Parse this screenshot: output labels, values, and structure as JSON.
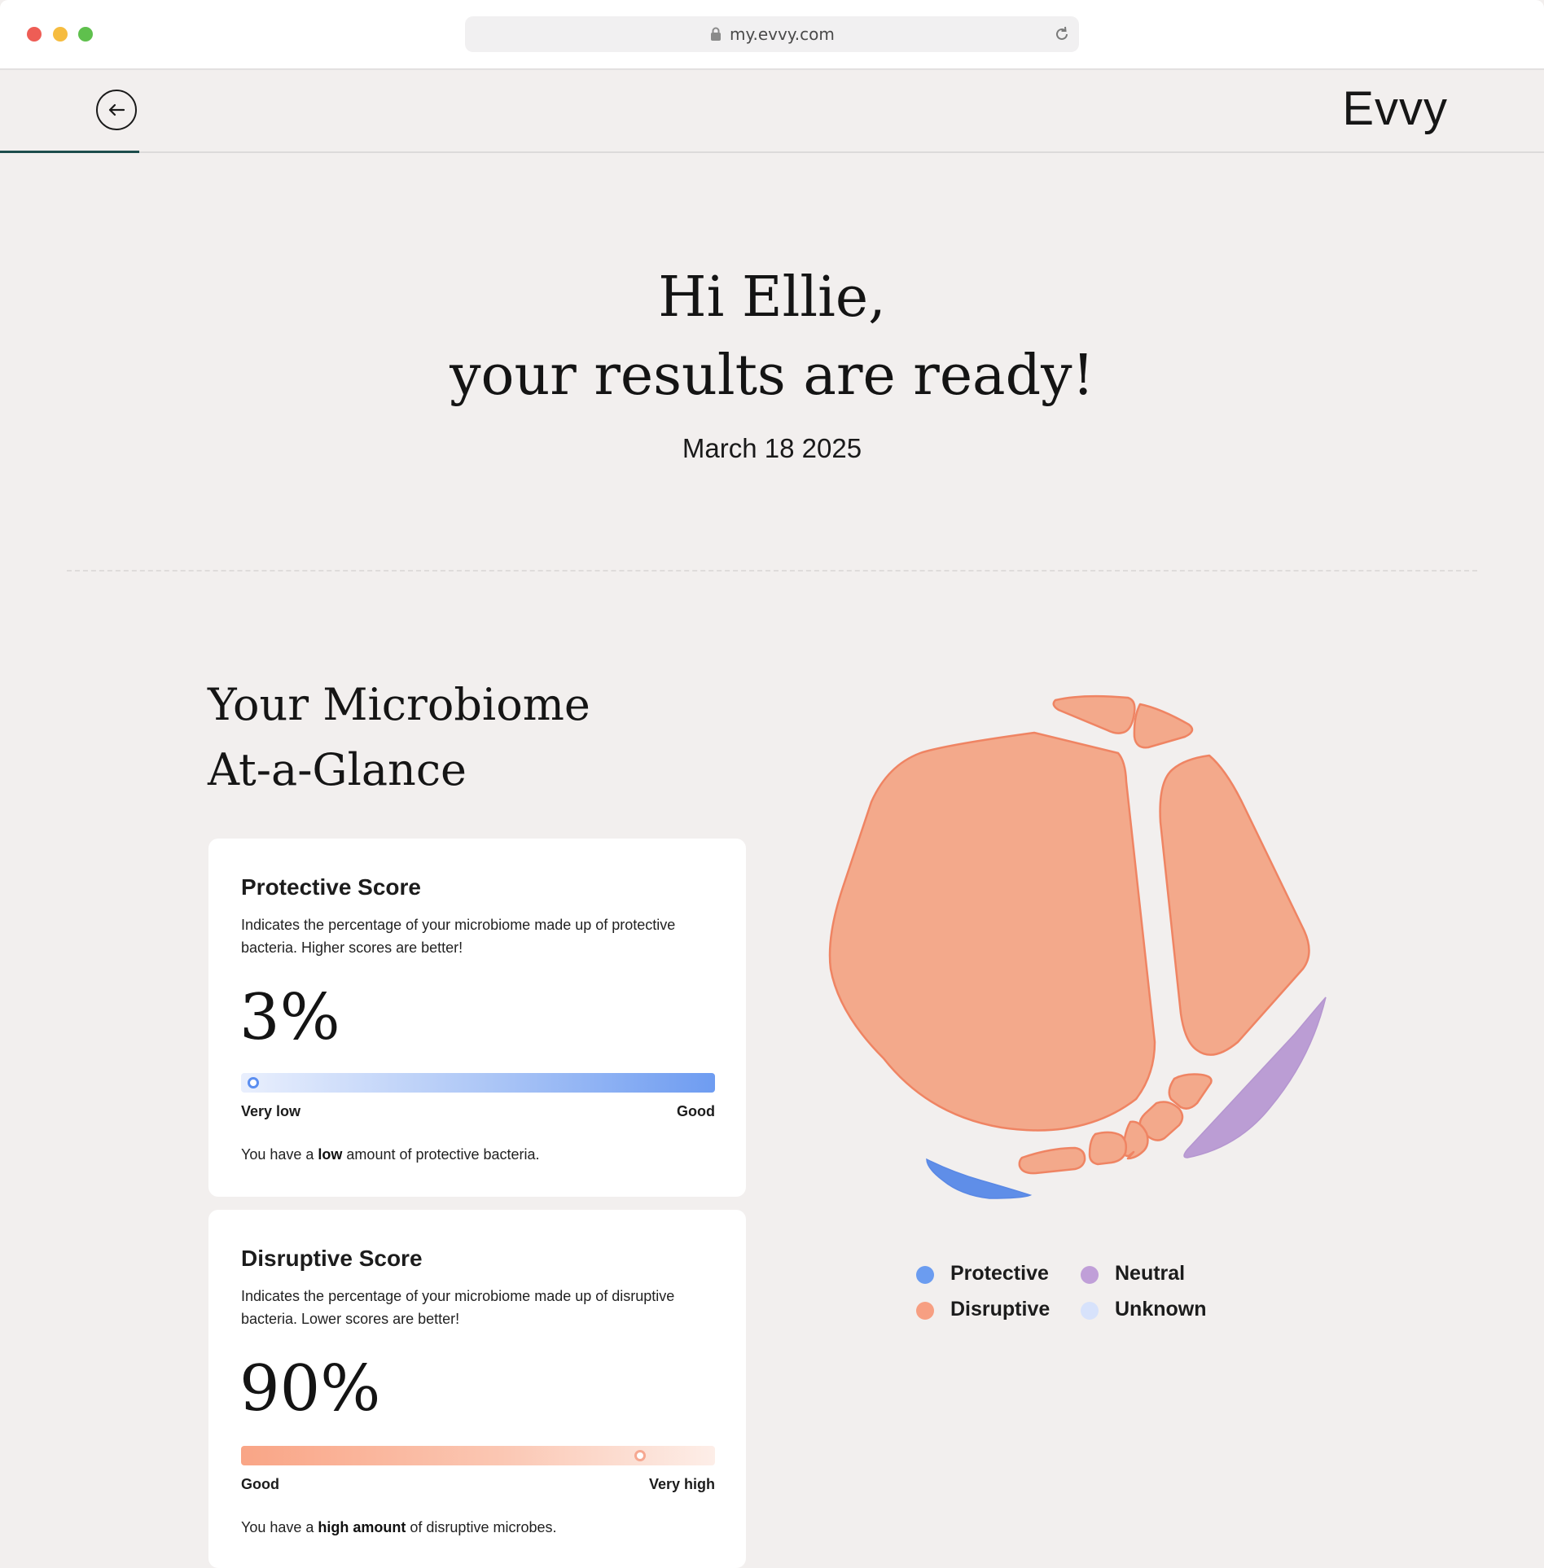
{
  "browser": {
    "url": "my.evvy.com"
  },
  "header": {
    "logo": "Evvy"
  },
  "hero": {
    "greeting": "Hi Ellie,",
    "headline": "your results are ready!",
    "date": "March 18 2025"
  },
  "section": {
    "title_line1": "Your Microbiome",
    "title_line2": "At-a-Glance"
  },
  "cards": {
    "protective": {
      "title": "Protective Score",
      "description": "Indicates the percentage of your microbiome made up of protective bacteria. Higher scores are better!",
      "score": "3%",
      "score_fraction": 0.03,
      "label_left": "Very low",
      "label_right": "Good",
      "summary_prefix": "You have a ",
      "summary_bold": "low",
      "summary_suffix": " amount of protective bacteria."
    },
    "disruptive": {
      "title": "Disruptive Score",
      "description": "Indicates the percentage of your microbiome made up of disruptive bacteria. Lower scores are better!",
      "score": "90%",
      "score_fraction": 0.9,
      "label_left": "Good",
      "label_right": "Very high",
      "summary_prefix": "You have a ",
      "summary_bold": "high amount",
      "summary_suffix": " of disruptive microbes."
    }
  },
  "legend": {
    "protective": {
      "label": "Protective",
      "color": "#6b9cf0"
    },
    "neutral": {
      "label": "Neutral",
      "color": "#c09fd8"
    },
    "disruptive": {
      "label": "Disruptive",
      "color": "#f79f82"
    },
    "unknown": {
      "label": "Unknown",
      "color": "#d7e2fb"
    }
  },
  "colors": {
    "background": "#f2efee",
    "accent": "#1d4d4c",
    "disruptive_fill": "#f3a98b",
    "disruptive_stroke": "#ef8463",
    "protective_fill": "#5f8ee8",
    "neutral_fill": "#bb9dd4"
  }
}
